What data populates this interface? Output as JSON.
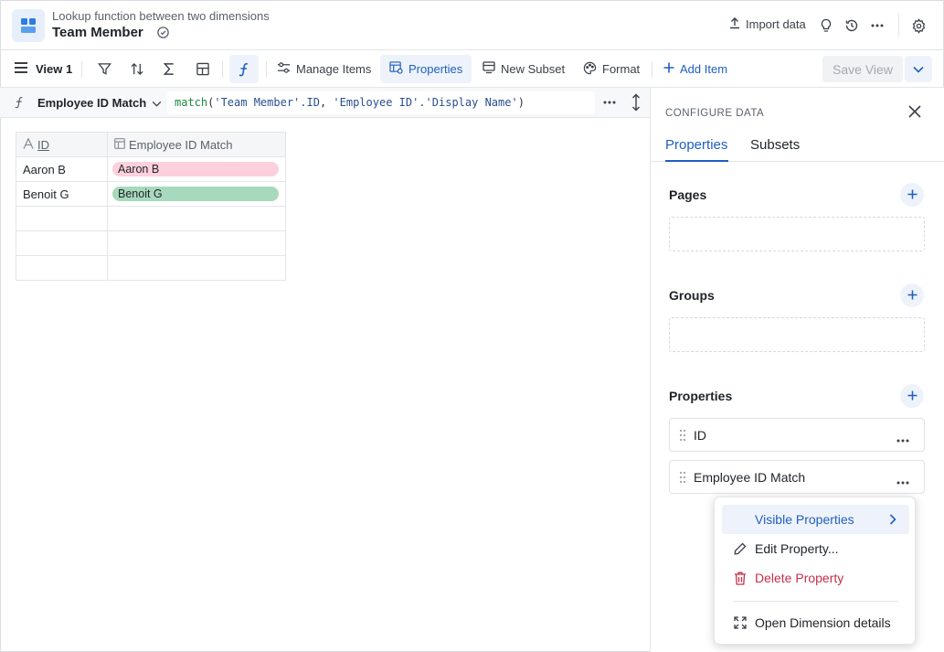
{
  "header": {
    "subtitle": "Lookup function between two dimensions",
    "title": "Team Member",
    "import_label": "Import data",
    "icons": [
      "app-grid-icon",
      "badge-icon",
      "upload-icon",
      "lightbulb-icon",
      "history-icon",
      "more-icon",
      "gear-icon"
    ]
  },
  "toolbar": {
    "view_label": "View 1",
    "manage_items": "Manage Items",
    "properties": "Properties",
    "new_subset": "New Subset",
    "format": "Format",
    "add_item": "Add Item",
    "save_view": "Save View"
  },
  "formula": {
    "property_name": "Employee ID Match",
    "fn": "match",
    "open_paren": "(",
    "arg1": "'Team Member'.ID",
    "comma": ", ",
    "arg2": "'Employee ID'.'Display Name'",
    "close_paren": ")"
  },
  "grid": {
    "columns": [
      "ID",
      "Employee ID Match"
    ],
    "rows": [
      {
        "id": "Aaron B",
        "match": "Aaron B",
        "color": "#fcd0dc"
      },
      {
        "id": "Benoit G",
        "match": "Benoit G",
        "color": "#a7d9bd"
      }
    ]
  },
  "panel": {
    "label": "CONFIGURE DATA",
    "tabs": [
      "Properties",
      "Subsets"
    ],
    "active_tab": "Properties",
    "sections": {
      "pages": "Pages",
      "groups": "Groups",
      "properties": "Properties"
    },
    "property_items": [
      "ID",
      "Employee ID Match"
    ]
  },
  "context_menu": {
    "items": [
      {
        "label": "Visible Properties",
        "icon": "",
        "state": "hover",
        "has_submenu": true
      },
      {
        "label": "Edit Property...",
        "icon": "pencil-icon"
      },
      {
        "label": "Delete Property",
        "icon": "trash-icon",
        "state": "danger"
      },
      {
        "label": "Open Dimension details",
        "icon": "expand-icon"
      }
    ]
  },
  "colors": {
    "accent": "#1f5fbf",
    "danger": "#c62f47",
    "pill_pink": "#fcd0dc",
    "pill_green": "#a7d9bd"
  }
}
